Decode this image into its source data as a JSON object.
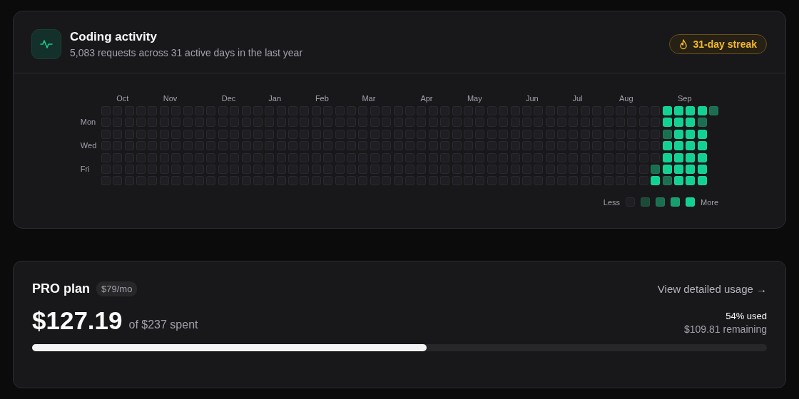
{
  "activity": {
    "title": "Coding activity",
    "subtitle": "5,083 requests across 31 active days in the last year",
    "streak": "31-day streak",
    "weekday_labels": [
      "Mon",
      "Wed",
      "Fri"
    ],
    "weeks": [
      {
        "days": [
          {
            "color": "#1f1f23"
          },
          {
            "color": "#1f1f23"
          },
          {
            "color": "#1f1f23"
          },
          {
            "color": "#1f1f23"
          },
          {
            "color": "#1f1f23"
          },
          {
            "color": "#1f1f23"
          },
          {
            "color": "#1f1f23"
          }
        ]
      },
      {
        "month": "Oct",
        "days": [
          {
            "color": "#1f1f23"
          },
          {
            "color": "#1f1f23"
          },
          {
            "color": "#1f1f23"
          },
          {
            "color": "#1f1f23"
          },
          {
            "color": "#1f1f23"
          },
          {
            "color": "#1f1f23"
          },
          {
            "color": "#1f1f23"
          }
        ]
      },
      {
        "days": [
          {
            "color": "#1f1f23"
          },
          {
            "color": "#1f1f23"
          },
          {
            "color": "#1f1f23"
          },
          {
            "color": "#1f1f23"
          },
          {
            "color": "#1f1f23"
          },
          {
            "color": "#1f1f23"
          },
          {
            "color": "#1f1f23"
          }
        ]
      },
      {
        "days": [
          {
            "color": "#1f1f23"
          },
          {
            "color": "#1f1f23"
          },
          {
            "color": "#1f1f23"
          },
          {
            "color": "#1f1f23"
          },
          {
            "color": "#1f1f23"
          },
          {
            "color": "#1f1f23"
          },
          {
            "color": "#1f1f23"
          }
        ]
      },
      {
        "days": [
          {
            "color": "#1f1f23"
          },
          {
            "color": "#1f1f23"
          },
          {
            "color": "#1f1f23"
          },
          {
            "color": "#1f1f23"
          },
          {
            "color": "#1f1f23"
          },
          {
            "color": "#1f1f23"
          },
          {
            "color": "#1f1f23"
          }
        ]
      },
      {
        "month": "Nov",
        "days": [
          {
            "color": "#1f1f23"
          },
          {
            "color": "#1f1f23"
          },
          {
            "color": "#1f1f23"
          },
          {
            "color": "#1f1f23"
          },
          {
            "color": "#1f1f23"
          },
          {
            "color": "#1f1f23"
          },
          {
            "color": "#1f1f23"
          }
        ]
      },
      {
        "days": [
          {
            "color": "#1f1f23"
          },
          {
            "color": "#1f1f23"
          },
          {
            "color": "#1f1f23"
          },
          {
            "color": "#1f1f23"
          },
          {
            "color": "#1f1f23"
          },
          {
            "color": "#1f1f23"
          },
          {
            "color": "#1f1f23"
          }
        ]
      },
      {
        "days": [
          {
            "color": "#1f1f23"
          },
          {
            "color": "#1f1f23"
          },
          {
            "color": "#1f1f23"
          },
          {
            "color": "#1f1f23"
          },
          {
            "color": "#1f1f23"
          },
          {
            "color": "#1f1f23"
          },
          {
            "color": "#1f1f23"
          }
        ]
      },
      {
        "days": [
          {
            "color": "#1f1f23"
          },
          {
            "color": "#1f1f23"
          },
          {
            "color": "#1f1f23"
          },
          {
            "color": "#1f1f23"
          },
          {
            "color": "#1f1f23"
          },
          {
            "color": "#1f1f23"
          },
          {
            "color": "#1f1f23"
          }
        ]
      },
      {
        "days": [
          {
            "color": "#1f1f23"
          },
          {
            "color": "#1f1f23"
          },
          {
            "color": "#1f1f23"
          },
          {
            "color": "#1f1f23"
          },
          {
            "color": "#1f1f23"
          },
          {
            "color": "#1f1f23"
          },
          {
            "color": "#1f1f23"
          }
        ]
      },
      {
        "month": "Dec",
        "days": [
          {
            "color": "#1f1f23"
          },
          {
            "color": "#1f1f23"
          },
          {
            "color": "#1f1f23"
          },
          {
            "color": "#1f1f23"
          },
          {
            "color": "#1f1f23"
          },
          {
            "color": "#1f1f23"
          },
          {
            "color": "#1f1f23"
          }
        ]
      },
      {
        "days": [
          {
            "color": "#1f1f23"
          },
          {
            "color": "#1f1f23"
          },
          {
            "color": "#1f1f23"
          },
          {
            "color": "#1f1f23"
          },
          {
            "color": "#1f1f23"
          },
          {
            "color": "#1f1f23"
          },
          {
            "color": "#1f1f23"
          }
        ]
      },
      {
        "days": [
          {
            "color": "#1f1f23"
          },
          {
            "color": "#1f1f23"
          },
          {
            "color": "#1f1f23"
          },
          {
            "color": "#1f1f23"
          },
          {
            "color": "#1f1f23"
          },
          {
            "color": "#1f1f23"
          },
          {
            "color": "#1f1f23"
          }
        ]
      },
      {
        "days": [
          {
            "color": "#1f1f23"
          },
          {
            "color": "#1f1f23"
          },
          {
            "color": "#1f1f23"
          },
          {
            "color": "#1f1f23"
          },
          {
            "color": "#1f1f23"
          },
          {
            "color": "#1f1f23"
          },
          {
            "color": "#1f1f23"
          }
        ]
      },
      {
        "month": "Jan",
        "days": [
          {
            "color": "#1f1f23"
          },
          {
            "color": "#1f1f23"
          },
          {
            "color": "#1f1f23"
          },
          {
            "color": "#1f1f23"
          },
          {
            "color": "#1f1f23"
          },
          {
            "color": "#1f1f23"
          },
          {
            "color": "#1f1f23"
          }
        ]
      },
      {
        "days": [
          {
            "color": "#1f1f23"
          },
          {
            "color": "#1f1f23"
          },
          {
            "color": "#1f1f23"
          },
          {
            "color": "#1f1f23"
          },
          {
            "color": "#1f1f23"
          },
          {
            "color": "#1f1f23"
          },
          {
            "color": "#1f1f23"
          }
        ]
      },
      {
        "days": [
          {
            "color": "#1f1f23"
          },
          {
            "color": "#1f1f23"
          },
          {
            "color": "#1f1f23"
          },
          {
            "color": "#1f1f23"
          },
          {
            "color": "#1f1f23"
          },
          {
            "color": "#1f1f23"
          },
          {
            "color": "#1f1f23"
          }
        ]
      },
      {
        "days": [
          {
            "color": "#1f1f23"
          },
          {
            "color": "#1f1f23"
          },
          {
            "color": "#1f1f23"
          },
          {
            "color": "#1f1f23"
          },
          {
            "color": "#1f1f23"
          },
          {
            "color": "#1f1f23"
          },
          {
            "color": "#1f1f23"
          }
        ]
      },
      {
        "month": "Feb",
        "days": [
          {
            "color": "#1f1f23"
          },
          {
            "color": "#1f1f23"
          },
          {
            "color": "#1f1f23"
          },
          {
            "color": "#1f1f23"
          },
          {
            "color": "#1f1f23"
          },
          {
            "color": "#1f1f23"
          },
          {
            "color": "#1f1f23"
          }
        ]
      },
      {
        "days": [
          {
            "color": "#1f1f23"
          },
          {
            "color": "#1f1f23"
          },
          {
            "color": "#1f1f23"
          },
          {
            "color": "#1f1f23"
          },
          {
            "color": "#1f1f23"
          },
          {
            "color": "#1f1f23"
          },
          {
            "color": "#1f1f23"
          }
        ]
      },
      {
        "days": [
          {
            "color": "#1f1f23"
          },
          {
            "color": "#1f1f23"
          },
          {
            "color": "#1f1f23"
          },
          {
            "color": "#1f1f23"
          },
          {
            "color": "#1f1f23"
          },
          {
            "color": "#1f1f23"
          },
          {
            "color": "#1f1f23"
          }
        ]
      },
      {
        "days": [
          {
            "color": "#1f1f23"
          },
          {
            "color": "#1f1f23"
          },
          {
            "color": "#1f1f23"
          },
          {
            "color": "#1f1f23"
          },
          {
            "color": "#1f1f23"
          },
          {
            "color": "#1f1f23"
          },
          {
            "color": "#1f1f23"
          }
        ]
      },
      {
        "month": "Mar",
        "days": [
          {
            "color": "#1f1f23"
          },
          {
            "color": "#1f1f23"
          },
          {
            "color": "#1f1f23"
          },
          {
            "color": "#1f1f23"
          },
          {
            "color": "#1f1f23"
          },
          {
            "color": "#1f1f23"
          },
          {
            "color": "#1f1f23"
          }
        ]
      },
      {
        "days": [
          {
            "color": "#1f1f23"
          },
          {
            "color": "#1f1f23"
          },
          {
            "color": "#1f1f23"
          },
          {
            "color": "#1f1f23"
          },
          {
            "color": "#1f1f23"
          },
          {
            "color": "#1f1f23"
          },
          {
            "color": "#1f1f23"
          }
        ]
      },
      {
        "days": [
          {
            "color": "#1f1f23"
          },
          {
            "color": "#1f1f23"
          },
          {
            "color": "#1f1f23"
          },
          {
            "color": "#1f1f23"
          },
          {
            "color": "#1f1f23"
          },
          {
            "color": "#1f1f23"
          },
          {
            "color": "#1f1f23"
          }
        ]
      },
      {
        "days": [
          {
            "color": "#1f1f23"
          },
          {
            "color": "#1f1f23"
          },
          {
            "color": "#1f1f23"
          },
          {
            "color": "#1f1f23"
          },
          {
            "color": "#1f1f23"
          },
          {
            "color": "#1f1f23"
          },
          {
            "color": "#1f1f23"
          }
        ]
      },
      {
        "days": [
          {
            "color": "#1f1f23"
          },
          {
            "color": "#1f1f23"
          },
          {
            "color": "#1f1f23"
          },
          {
            "color": "#1f1f23"
          },
          {
            "color": "#1f1f23"
          },
          {
            "color": "#1f1f23"
          },
          {
            "color": "#1f1f23"
          }
        ]
      },
      {
        "month": "Apr",
        "days": [
          {
            "color": "#1f1f23"
          },
          {
            "color": "#1f1f23"
          },
          {
            "color": "#1f1f23"
          },
          {
            "color": "#1f1f23"
          },
          {
            "color": "#1f1f23"
          },
          {
            "color": "#1f1f23"
          },
          {
            "color": "#1f1f23"
          }
        ]
      },
      {
        "days": [
          {
            "color": "#1f1f23"
          },
          {
            "color": "#1f1f23"
          },
          {
            "color": "#1f1f23"
          },
          {
            "color": "#1f1f23"
          },
          {
            "color": "#1f1f23"
          },
          {
            "color": "#1f1f23"
          },
          {
            "color": "#1f1f23"
          }
        ]
      },
      {
        "days": [
          {
            "color": "#1f1f23"
          },
          {
            "color": "#1f1f23"
          },
          {
            "color": "#1f1f23"
          },
          {
            "color": "#1f1f23"
          },
          {
            "color": "#1f1f23"
          },
          {
            "color": "#1f1f23"
          },
          {
            "color": "#1f1f23"
          }
        ]
      },
      {
        "days": [
          {
            "color": "#1f1f23"
          },
          {
            "color": "#1f1f23"
          },
          {
            "color": "#1f1f23"
          },
          {
            "color": "#1f1f23"
          },
          {
            "color": "#1f1f23"
          },
          {
            "color": "#1f1f23"
          },
          {
            "color": "#1f1f23"
          }
        ]
      },
      {
        "month": "May",
        "days": [
          {
            "color": "#1f1f23"
          },
          {
            "color": "#1f1f23"
          },
          {
            "color": "#1f1f23"
          },
          {
            "color": "#1f1f23"
          },
          {
            "color": "#1f1f23"
          },
          {
            "color": "#1f1f23"
          },
          {
            "color": "#1f1f23"
          }
        ]
      },
      {
        "days": [
          {
            "color": "#1f1f23"
          },
          {
            "color": "#1f1f23"
          },
          {
            "color": "#1f1f23"
          },
          {
            "color": "#1f1f23"
          },
          {
            "color": "#1f1f23"
          },
          {
            "color": "#1f1f23"
          },
          {
            "color": "#1f1f23"
          }
        ]
      },
      {
        "days": [
          {
            "color": "#1f1f23"
          },
          {
            "color": "#1f1f23"
          },
          {
            "color": "#1f1f23"
          },
          {
            "color": "#1f1f23"
          },
          {
            "color": "#1f1f23"
          },
          {
            "color": "#1f1f23"
          },
          {
            "color": "#1f1f23"
          }
        ]
      },
      {
        "days": [
          {
            "color": "#1f1f23"
          },
          {
            "color": "#1f1f23"
          },
          {
            "color": "#1f1f23"
          },
          {
            "color": "#1f1f23"
          },
          {
            "color": "#1f1f23"
          },
          {
            "color": "#1f1f23"
          },
          {
            "color": "#1f1f23"
          }
        ]
      },
      {
        "days": [
          {
            "color": "#1f1f23"
          },
          {
            "color": "#1f1f23"
          },
          {
            "color": "#1f1f23"
          },
          {
            "color": "#1f1f23"
          },
          {
            "color": "#1f1f23"
          },
          {
            "color": "#1f1f23"
          },
          {
            "color": "#1f1f23"
          }
        ]
      },
      {
        "month": "Jun",
        "days": [
          {
            "color": "#1f1f23"
          },
          {
            "color": "#1f1f23"
          },
          {
            "color": "#1f1f23"
          },
          {
            "color": "#1f1f23"
          },
          {
            "color": "#1f1f23"
          },
          {
            "color": "#1f1f23"
          },
          {
            "color": "#1f1f23"
          }
        ]
      },
      {
        "days": [
          {
            "color": "#1f1f23"
          },
          {
            "color": "#1f1f23"
          },
          {
            "color": "#1f1f23"
          },
          {
            "color": "#1f1f23"
          },
          {
            "color": "#1f1f23"
          },
          {
            "color": "#1f1f23"
          },
          {
            "color": "#1f1f23"
          }
        ]
      },
      {
        "days": [
          {
            "color": "#1f1f23"
          },
          {
            "color": "#1f1f23"
          },
          {
            "color": "#1f1f23"
          },
          {
            "color": "#1f1f23"
          },
          {
            "color": "#1f1f23"
          },
          {
            "color": "#1f1f23"
          },
          {
            "color": "#1f1f23"
          }
        ]
      },
      {
        "days": [
          {
            "color": "#1f1f23"
          },
          {
            "color": "#1f1f23"
          },
          {
            "color": "#1f1f23"
          },
          {
            "color": "#1f1f23"
          },
          {
            "color": "#1f1f23"
          },
          {
            "color": "#1f1f23"
          },
          {
            "color": "#1f1f23"
          }
        ]
      },
      {
        "month": "Jul",
        "days": [
          {
            "color": "#1f1f23"
          },
          {
            "color": "#1f1f23"
          },
          {
            "color": "#1f1f23"
          },
          {
            "color": "#1f1f23"
          },
          {
            "color": "#1f1f23"
          },
          {
            "color": "#1f1f23"
          },
          {
            "color": "#1f1f23"
          }
        ]
      },
      {
        "days": [
          {
            "color": "#1f1f23"
          },
          {
            "color": "#1f1f23"
          },
          {
            "color": "#1f1f23"
          },
          {
            "color": "#1f1f23"
          },
          {
            "color": "#1f1f23"
          },
          {
            "color": "#1f1f23"
          },
          {
            "color": "#1f1f23"
          }
        ]
      },
      {
        "days": [
          {
            "color": "#1f1f23"
          },
          {
            "color": "#1f1f23"
          },
          {
            "color": "#1f1f23"
          },
          {
            "color": "#1f1f23"
          },
          {
            "color": "#1f1f23"
          },
          {
            "color": "#1f1f23"
          },
          {
            "color": "#1f1f23"
          }
        ]
      },
      {
        "days": [
          {
            "color": "#1f1f23"
          },
          {
            "color": "#1f1f23"
          },
          {
            "color": "#1f1f23"
          },
          {
            "color": "#1f1f23"
          },
          {
            "color": "#1f1f23"
          },
          {
            "color": "#1f1f23"
          },
          {
            "color": "#1f1f23"
          }
        ]
      },
      {
        "month": "Aug",
        "days": [
          {
            "color": "#1f1f23"
          },
          {
            "color": "#1f1f23"
          },
          {
            "color": "#1f1f23"
          },
          {
            "color": "#1f1f23"
          },
          {
            "color": "#1f1f23"
          },
          {
            "color": "#1f1f23"
          },
          {
            "color": "#1f1f23"
          }
        ]
      },
      {
        "days": [
          {
            "color": "#1f1f23"
          },
          {
            "color": "#1f1f23"
          },
          {
            "color": "#1f1f23"
          },
          {
            "color": "#1f1f23"
          },
          {
            "color": "#1f1f23"
          },
          {
            "color": "#1f1f23"
          },
          {
            "color": "#1f1f23"
          }
        ]
      },
      {
        "days": [
          {
            "color": "#1f1f23"
          },
          {
            "color": "#1f1f23"
          },
          {
            "color": "#1f1f23"
          },
          {
            "color": "#1f1f23"
          },
          {
            "color": "#1f1f23"
          },
          {
            "color": "#1f1f23"
          },
          {
            "color": "#1f1f23"
          }
        ]
      },
      {
        "days": [
          {
            "color": "#1f1f23"
          },
          {
            "color": "#1f1f23"
          },
          {
            "color": "#1f1f23"
          },
          {
            "color": "#1f1f23"
          },
          {
            "color": "#1f1f23"
          },
          {
            "color": "#1b6f51"
          },
          {
            "color": "#12d293"
          }
        ]
      },
      {
        "days": [
          {
            "color": "#12d293"
          },
          {
            "color": "#12d293"
          },
          {
            "color": "#1b6f51"
          },
          {
            "color": "#12d293"
          },
          {
            "color": "#12d293"
          },
          {
            "color": "#12d293"
          },
          {
            "color": "#1b6f51"
          }
        ]
      },
      {
        "month": "Sep",
        "days": [
          {
            "color": "#12d293"
          },
          {
            "color": "#12d293"
          },
          {
            "color": "#12d293"
          },
          {
            "color": "#12d293"
          },
          {
            "color": "#12d293"
          },
          {
            "color": "#12d293"
          },
          {
            "color": "#12d293"
          }
        ]
      },
      {
        "days": [
          {
            "color": "#12d293"
          },
          {
            "color": "#12d293"
          },
          {
            "color": "#12d293"
          },
          {
            "color": "#12d293"
          },
          {
            "color": "#12d293"
          },
          {
            "color": "#12d293"
          },
          {
            "color": "#12d293"
          }
        ]
      },
      {
        "days": [
          {
            "color": "#12d293"
          },
          {
            "color": "#1b6f51"
          },
          {
            "color": "#12d293"
          },
          {
            "color": "#12d293"
          },
          {
            "color": "#12d293"
          },
          {
            "color": "#12d293"
          },
          {
            "color": "#12d293"
          }
        ]
      },
      {
        "days": [
          {
            "color": "#1b6f51"
          }
        ]
      }
    ],
    "legend": {
      "less": "Less",
      "more": "More",
      "swatches": [
        {
          "color": "#1f1f23"
        },
        {
          "color": "#1b4a39"
        },
        {
          "color": "#1b6f51"
        },
        {
          "color": "#17a06f"
        },
        {
          "color": "#12d293"
        }
      ]
    }
  },
  "plan": {
    "name": "PRO plan",
    "price": "$79/mo",
    "link": "View detailed usage →",
    "spent": "$127.19",
    "of_total": "of $237 spent",
    "used": "54% used",
    "remaining": "$109.81 remaining",
    "level": 0.537
  }
}
